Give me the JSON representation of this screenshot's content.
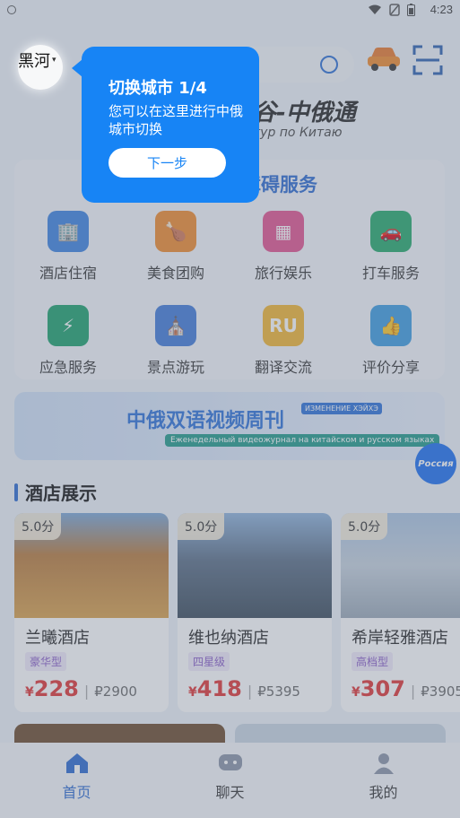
{
  "status_bar": {
    "time": "4:23"
  },
  "header": {
    "city": "黑河",
    "caret": "▾",
    "banner_title": "谷-中俄通",
    "banner_subtitle": "тур по Китаю"
  },
  "services": {
    "title": "障碍服务",
    "items": [
      {
        "label": "酒店住宿",
        "icon": "hotel-icon",
        "color": "#3a82e0"
      },
      {
        "label": "美食团购",
        "icon": "food-icon",
        "color": "#f08a2a"
      },
      {
        "label": "旅行娱乐",
        "icon": "entertainment-icon",
        "color": "#e2528f"
      },
      {
        "label": "打车服务",
        "icon": "taxi-icon",
        "color": "#23a86a"
      },
      {
        "label": "应急服务",
        "icon": "emergency-icon",
        "color": "#1aa06b"
      },
      {
        "label": "景点游玩",
        "icon": "attraction-icon",
        "color": "#3f7ad8"
      },
      {
        "label": "翻译交流",
        "icon": "translate-icon",
        "color": "#f2b530"
      },
      {
        "label": "评价分享",
        "icon": "review-icon",
        "color": "#3a9be0"
      }
    ]
  },
  "promo": {
    "title": "中俄双语视频周刊",
    "tag": "ИЗМЕНЕНИЕ ХЭЙХЭ",
    "subtitle_ru": "Еженедельный видеожурнал на китайском и русском языках"
  },
  "russia_button": "Россия",
  "hotel_section": {
    "title": "酒店展示",
    "hotels": [
      {
        "score": "5.0分",
        "name": "兰曦酒店",
        "tag": "豪华型",
        "cny_symbol": "¥",
        "cny": "228",
        "rub": "₽2900",
        "photo_color": "#b87a3a"
      },
      {
        "score": "5.0分",
        "name": "维也纳酒店",
        "tag": "四星级",
        "cny_symbol": "¥",
        "cny": "418",
        "rub": "₽5395",
        "photo_color": "#5a6e86"
      },
      {
        "score": "5.0分",
        "name": "希岸轻雅酒店",
        "tag": "高档型",
        "cny_symbol": "¥",
        "cny": "307",
        "rub": "₽3905",
        "photo_color": "#c6d2de"
      }
    ]
  },
  "tabbar": {
    "tabs": [
      {
        "label": "首页",
        "icon": "home-icon"
      },
      {
        "label": "聊天",
        "icon": "chat-icon"
      },
      {
        "label": "我的",
        "icon": "profile-icon"
      }
    ]
  },
  "guide_tooltip": {
    "title": "切换城市 1/4",
    "body": "您可以在这里进行中俄城市切换",
    "next_button": "下一步"
  },
  "colors": {
    "accent": "#1784f5",
    "price": "#e03232",
    "primary_text": "#2b6ad0"
  }
}
